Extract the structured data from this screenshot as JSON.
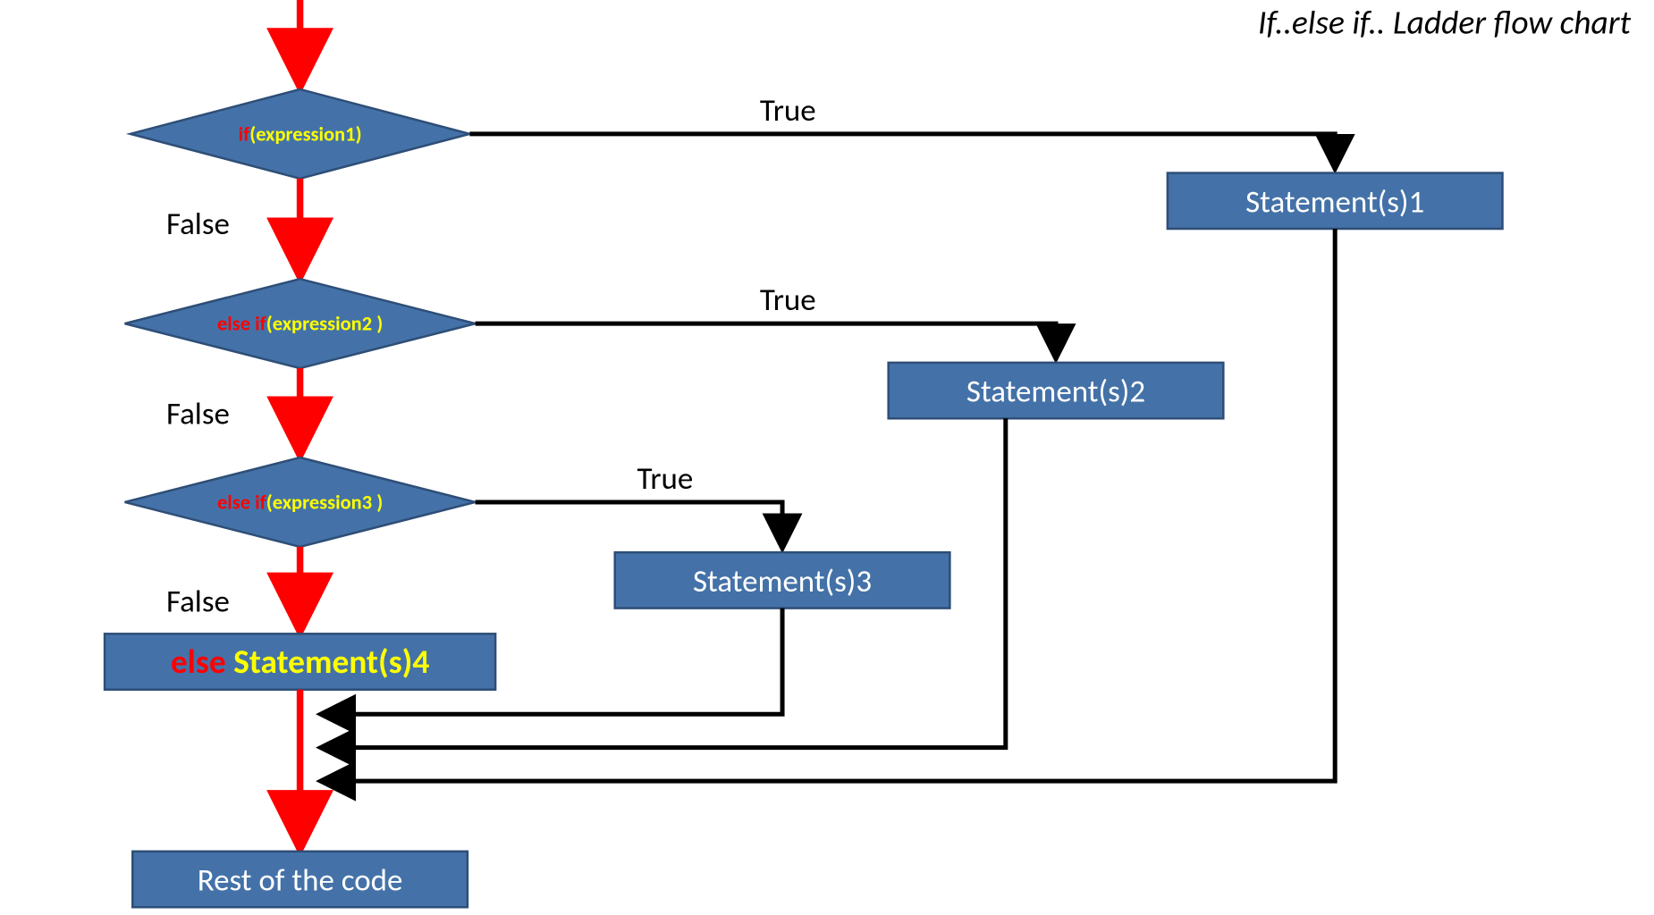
{
  "title": "If..else if.. Ladder flow chart",
  "decisions": {
    "d1": {
      "keyword": "if",
      "expr": "(expression1)"
    },
    "d2": {
      "keyword": "else if",
      "expr": "(expression2 )"
    },
    "d3": {
      "keyword": "else if",
      "expr": "(expression3 )"
    }
  },
  "statements": {
    "s1": "Statement(s)1",
    "s2": "Statement(s)2",
    "s3": "Statement(s)3",
    "else_kw": "else",
    "else_stmt": " Statement(s)4",
    "rest": "Rest of the code"
  },
  "labels": {
    "true": "True",
    "false": "False"
  },
  "colors": {
    "node_fill": "#4472a8",
    "node_stroke": "#2e4e77",
    "flow_true": "#000000",
    "flow_false": "#ff0000"
  }
}
